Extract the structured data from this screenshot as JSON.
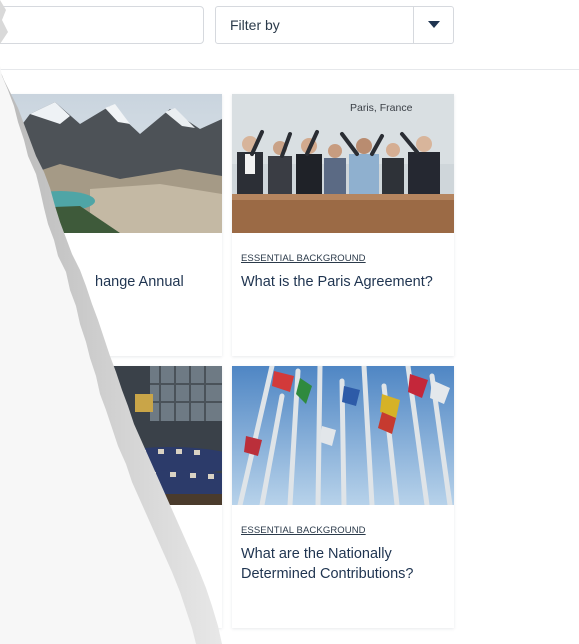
{
  "filter": {
    "search_value": "",
    "filter_label": "Filter by"
  },
  "cards": [
    {
      "category": "",
      "title": "hange Annual",
      "image_caption": ""
    },
    {
      "category": "ESSENTIAL BACKGROUND",
      "title": "What is the Paris Agreement?",
      "image_caption": "Paris, France"
    },
    {
      "category": "",
      "title": "",
      "image_caption": ""
    },
    {
      "category": "ESSENTIAL BACKGROUND",
      "title": "What are the Nationally Determined Contributions?",
      "image_caption": ""
    }
  ],
  "colors": {
    "title_text": "#1f3450",
    "border": "#d6d9de",
    "background": "#ffffff"
  }
}
